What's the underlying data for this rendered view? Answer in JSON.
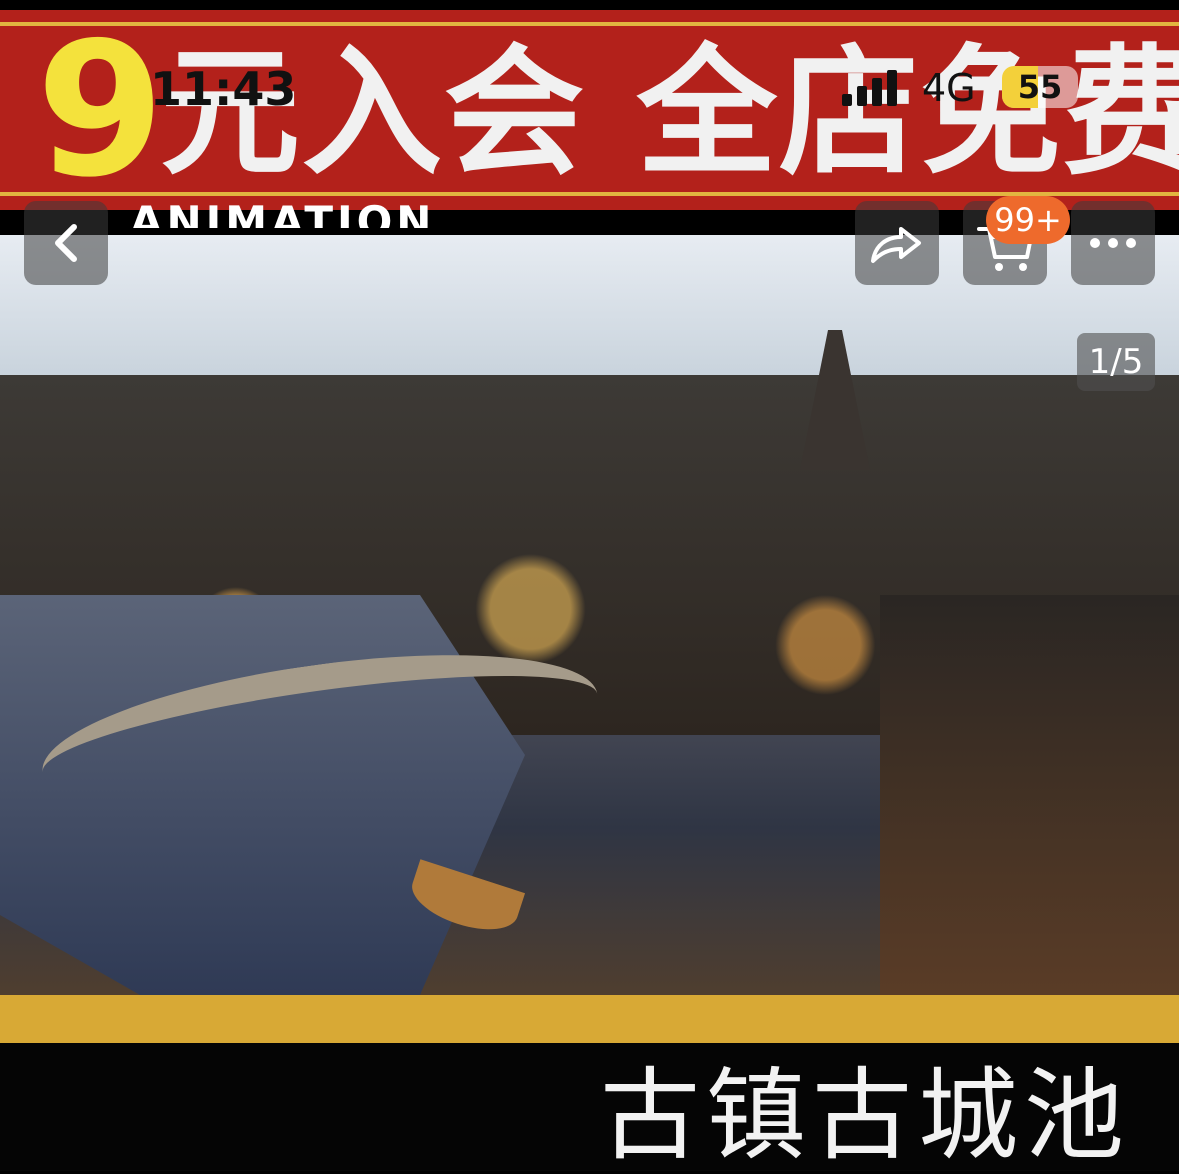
{
  "banner": {
    "number": "9",
    "text": "元入会 全店免费",
    "subtext": "ANIMATION"
  },
  "status_bar": {
    "time": "11:43",
    "network": "4G",
    "battery": "55"
  },
  "nav": {
    "back_icon": "chevron-left-icon",
    "share_icon": "share-icon",
    "cart_icon": "cart-icon",
    "cart_badge": "99+",
    "more_icon": "more-icon"
  },
  "gallery": {
    "counter": "1/5"
  },
  "product": {
    "caption": "古镇古城池"
  },
  "colors": {
    "banner_red": "#b3211b",
    "accent_yellow": "#f4e23c",
    "badge_orange": "#ee6a2c",
    "band_gold": "#d8a935"
  }
}
